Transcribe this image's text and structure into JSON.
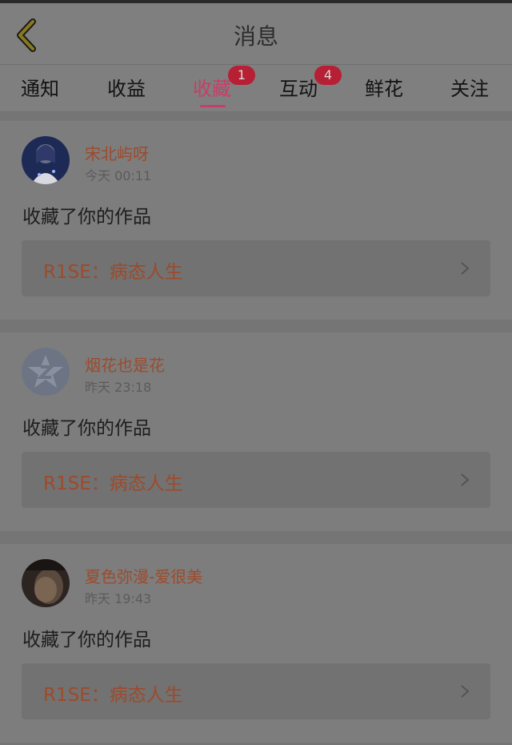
{
  "header": {
    "title": "消息",
    "back_icon": "chevron-left-icon"
  },
  "tabs": [
    {
      "label": "通知",
      "badge": ""
    },
    {
      "label": "收益",
      "badge": ""
    },
    {
      "label": "收藏",
      "badge": "1",
      "active": true
    },
    {
      "label": "互动",
      "badge": "4"
    },
    {
      "label": "鲜花",
      "badge": ""
    },
    {
      "label": "关注",
      "badge": ""
    }
  ],
  "notifications": [
    {
      "user": "宋北屿呀",
      "time": "今天 00:11",
      "action": "收藏了你的作品",
      "work": "R1SE：病态人生",
      "avatar": "photo-avatar-icon"
    },
    {
      "user": "烟花也是花",
      "time": "昨天 23:18",
      "action": "收藏了你的作品",
      "work": "R1SE：病态人生",
      "avatar": "default-star-avatar-icon"
    },
    {
      "user": "夏色弥漫-爱很美",
      "time": "昨天 19:43",
      "action": "收藏了你的作品",
      "work": "R1SE：病态人生",
      "avatar": "photo-avatar-icon"
    }
  ],
  "colors": {
    "accent": "#c83d69",
    "badge": "#b61f34",
    "username": "#9d4a2b"
  }
}
